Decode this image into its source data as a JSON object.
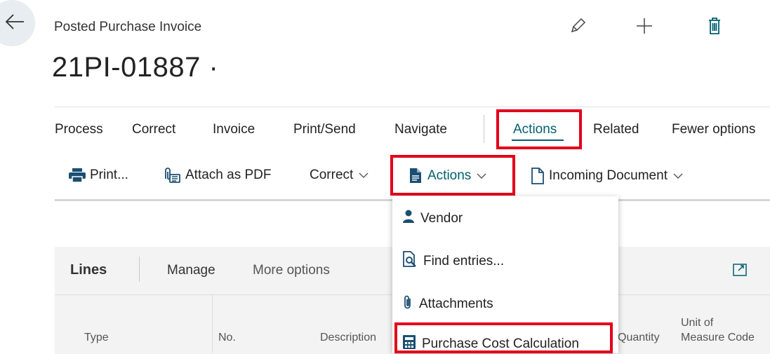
{
  "header": {
    "caption": "Posted Purchase Invoice",
    "title": "21PI-01887 ·"
  },
  "tabs": [
    {
      "label": "Process"
    },
    {
      "label": "Correct"
    },
    {
      "label": "Invoice"
    },
    {
      "label": "Print/Send"
    },
    {
      "label": "Navigate"
    },
    {
      "label": "Actions"
    },
    {
      "label": "Related"
    },
    {
      "label": "Fewer options"
    }
  ],
  "ribbon": {
    "print": "Print...",
    "attach_pdf": "Attach as PDF",
    "correct": "Correct",
    "actions": "Actions",
    "incoming_document": "Incoming Document"
  },
  "actions_menu": {
    "items": [
      {
        "label": "Vendor",
        "icon": "person-icon"
      },
      {
        "label": "Find entries...",
        "icon": "find-entries-icon"
      },
      {
        "label": "Attachments",
        "icon": "paperclip-icon"
      },
      {
        "label": "Purchase Cost Calculation",
        "icon": "calculation-icon"
      }
    ]
  },
  "lines": {
    "title": "Lines",
    "manage": "Manage",
    "more_options": "More options",
    "columns": {
      "type": "Type",
      "no": "No.",
      "description": "Description",
      "quantity": "Quantity",
      "uom_line1": "Unit of",
      "uom_line2": "Measure Code"
    }
  },
  "colors": {
    "accent": "#00606f",
    "highlight_box": "#e3001b",
    "icon_dark": "#1b4f72"
  }
}
